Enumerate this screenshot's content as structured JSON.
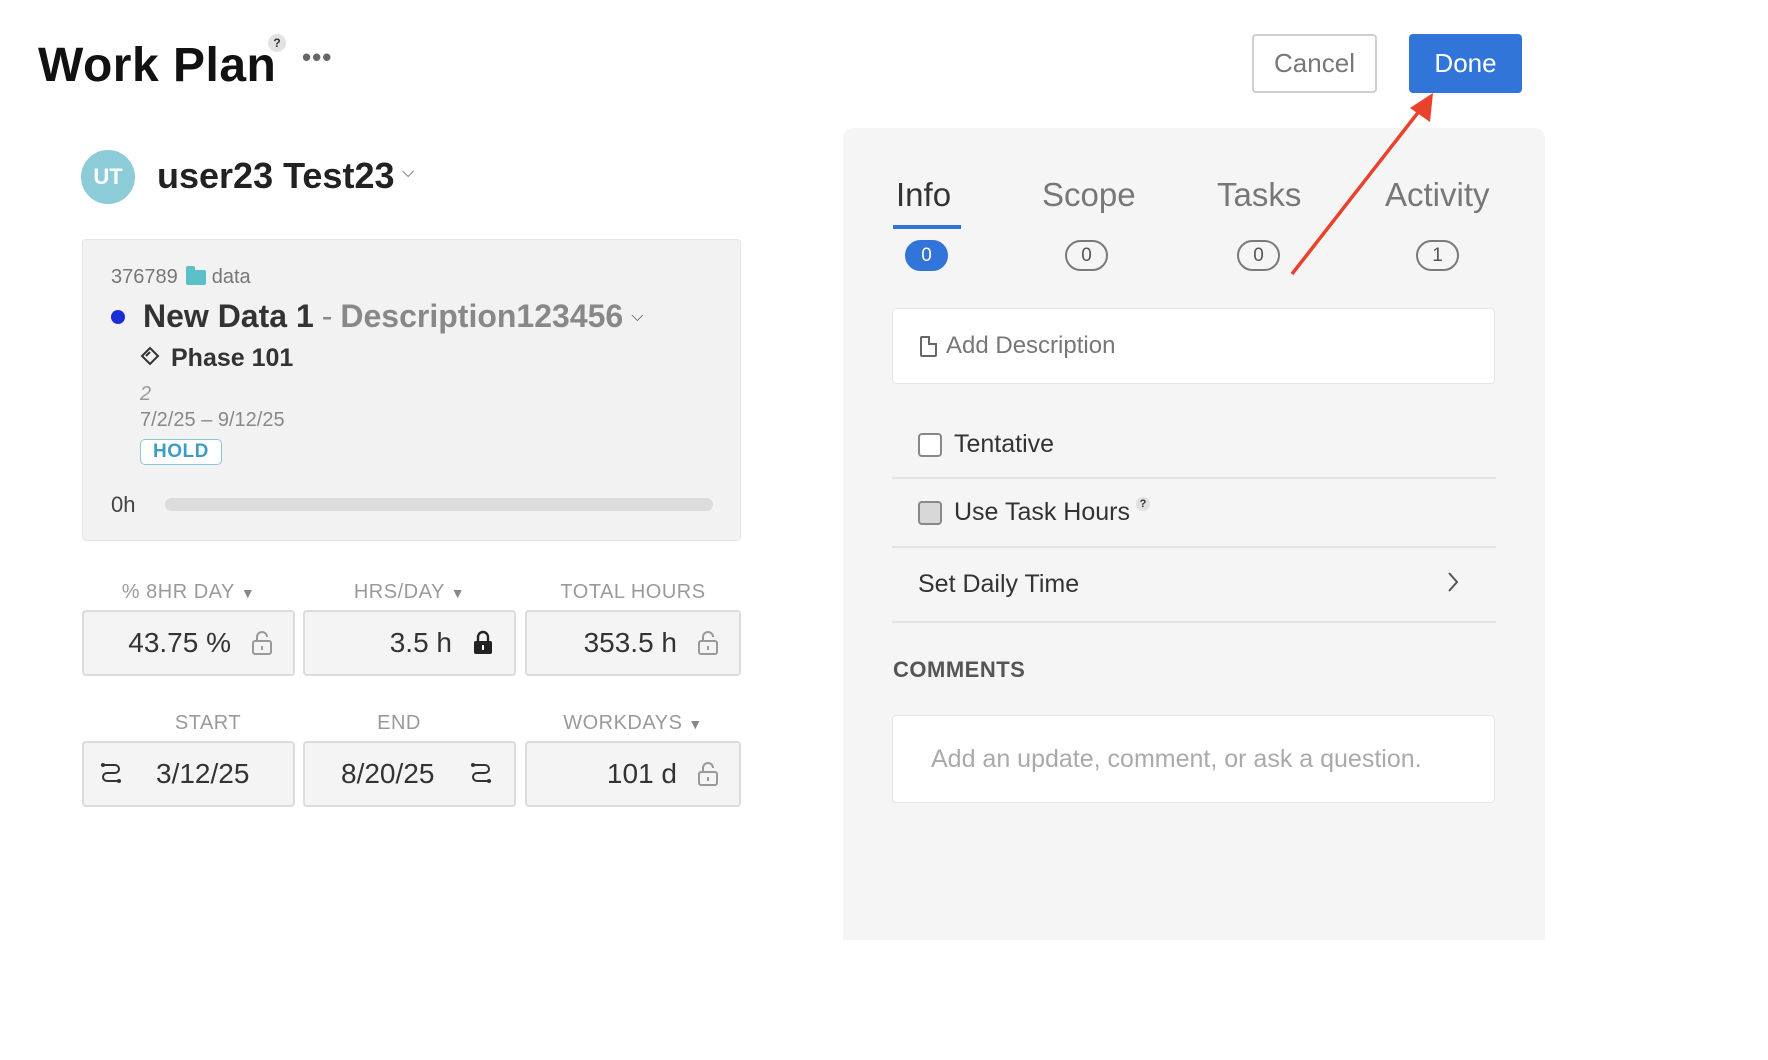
{
  "header": {
    "title": "Work Plan",
    "help_glyph": "?",
    "more_glyph": "•••",
    "cancel_label": "Cancel",
    "done_label": "Done"
  },
  "user": {
    "initials": "UT",
    "name": "user23 Test23",
    "avatar_color": "#8ccbd8"
  },
  "project": {
    "id": "376789",
    "folder_icon": "folder-icon",
    "folder_name": "data",
    "name": "New Data 1",
    "separator": "-",
    "description": "Description123456",
    "dot_color": "#1a2ed8",
    "phase_name": "Phase 101",
    "phase_number": "2",
    "phase_dates": "7/2/25 – 9/12/25",
    "status": "HOLD",
    "hours": "0h",
    "progress": 0
  },
  "stats": {
    "pct_day": {
      "label": "% 8HR DAY",
      "value": "43.75 %",
      "locked": false
    },
    "hrs_day": {
      "label": "HRS/DAY",
      "value": "3.5 h",
      "locked": true
    },
    "total_hours": {
      "label": "TOTAL HOURS",
      "value": "353.5 h",
      "locked": false
    },
    "start": {
      "label": "START",
      "value": "3/12/25"
    },
    "end": {
      "label": "END",
      "value": "8/20/25"
    },
    "workdays": {
      "label": "WORKDAYS",
      "value": "101 d",
      "locked": false
    }
  },
  "panel": {
    "tabs": [
      {
        "label": "Info",
        "count": "0",
        "active": true
      },
      {
        "label": "Scope",
        "count": "0",
        "active": false
      },
      {
        "label": "Tasks",
        "count": "0",
        "active": false
      },
      {
        "label": "Activity",
        "count": "1",
        "active": false
      }
    ],
    "add_description": "Add Description",
    "tentative_label": "Tentative",
    "use_task_hours_label": "Use Task Hours",
    "set_daily_time_label": "Set Daily Time",
    "comments_label": "COMMENTS",
    "comment_placeholder": "Add an update, comment, or ask a question."
  },
  "colors": {
    "accent": "#3275d8",
    "annotation_arrow": "#e8412c"
  }
}
